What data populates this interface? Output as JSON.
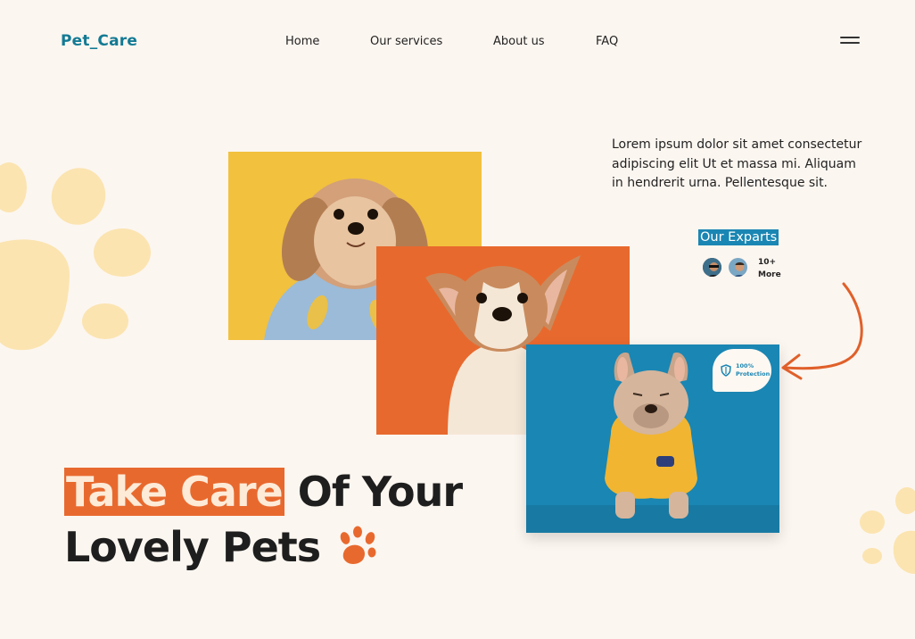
{
  "brand": {
    "logo": "Pet_Care"
  },
  "nav": {
    "items": [
      "Home",
      "Our services",
      "About us",
      "FAQ"
    ]
  },
  "hero": {
    "intro": "Lorem ipsum dolor sit amet consectetur adipiscing elit Ut et massa mi. Aliquam in hendrerit urna. Pellentesque sit.",
    "experts_title": "Our Exparts",
    "experts_more_count": "10+",
    "experts_more_label": "More",
    "badge_line1": "100%",
    "badge_line2": "Protection",
    "headline_highlight": "Take Care",
    "headline_rest": "Of Your",
    "headline_line2": "Lovely Pets"
  },
  "colors": {
    "brand": "#137a94",
    "accent_orange": "#e8692e",
    "accent_blue": "#1a86b3",
    "paw_yellow": "#fbe4b0",
    "photo_yellow": "#f2c13e",
    "background": "#fcf6f0"
  },
  "icons": {
    "menu": "hamburger-icon",
    "shield": "shield-icon",
    "paw": "paw-icon"
  }
}
